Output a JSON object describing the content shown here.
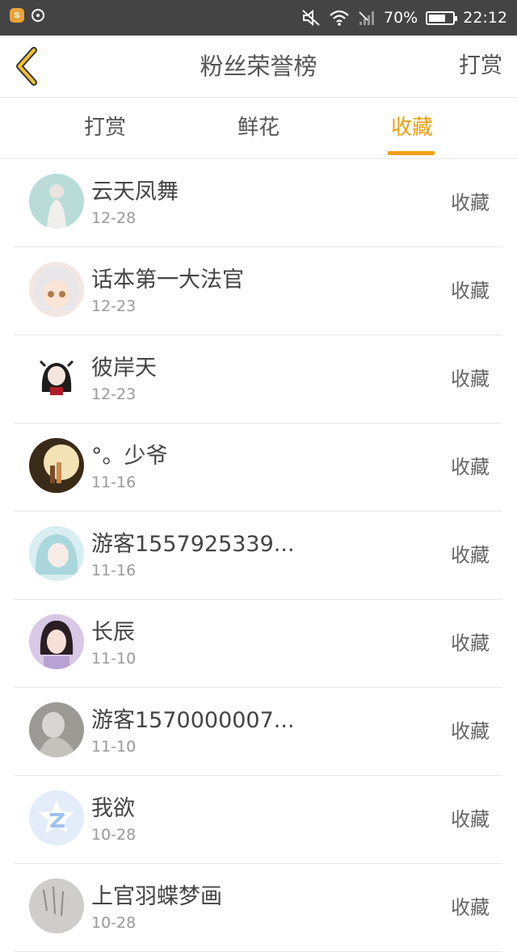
{
  "status_bar": {
    "battery": "70%",
    "battery_level": 0.7,
    "time": "22:12"
  },
  "nav": {
    "title": "粉丝荣誉榜",
    "action": "打赏"
  },
  "tabs": [
    {
      "label": "打赏",
      "active": false
    },
    {
      "label": "鲜花",
      "active": false
    },
    {
      "label": "收藏",
      "active": true
    }
  ],
  "colors": {
    "accent": "#f0a010",
    "status_bar": "#444444",
    "text": "#444444",
    "muted": "#999999"
  },
  "fans": [
    {
      "name": "云天凤舞",
      "date": "12-28",
      "type": "收藏",
      "avatar": "avatar-photo-girl-icon"
    },
    {
      "name": "话本第一大法官",
      "date": "12-23",
      "type": "收藏",
      "avatar": "avatar-anime-girl-icon"
    },
    {
      "name": "彼岸天",
      "date": "12-23",
      "type": "收藏",
      "avatar": "avatar-anime-dark-icon"
    },
    {
      "name": "°。少爷",
      "date": "11-16",
      "type": "收藏",
      "avatar": "avatar-sunset-couple-icon"
    },
    {
      "name": "游客1557925339...",
      "date": "11-16",
      "type": "收藏",
      "avatar": "avatar-anime-blue-icon"
    },
    {
      "name": "长辰",
      "date": "11-10",
      "type": "收藏",
      "avatar": "avatar-illustrated-woman-icon"
    },
    {
      "name": "游客1570000007...",
      "date": "11-10",
      "type": "收藏",
      "avatar": "avatar-grey-photo-icon"
    },
    {
      "name": "我欲",
      "date": "10-28",
      "type": "收藏",
      "avatar": "avatar-qzone-default-icon"
    },
    {
      "name": "上官羽蝶梦画",
      "date": "10-28",
      "type": "收藏",
      "avatar": "avatar-sketch-icon"
    }
  ]
}
